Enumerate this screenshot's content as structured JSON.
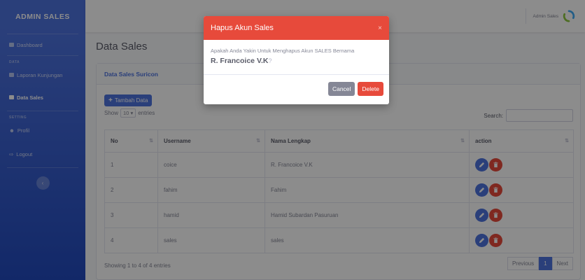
{
  "sidebar": {
    "brand": "ADMIN SALES",
    "dashboard": "Dashboard",
    "heading_data": "DATA",
    "laporan": "Laporan Kunjungan",
    "data_sales": "Data Sales",
    "heading_setting": "SETTING",
    "profil": "Profil",
    "logout": "Logout",
    "toggle": "‹"
  },
  "topbar": {
    "user_name": "Admin Sales"
  },
  "page": {
    "title": "Data Sales",
    "card_title": "Data Sales Suricon",
    "add_button": "Tambah Data",
    "show_label": "Show",
    "page_length": "10",
    "entries_label": "entries",
    "search_label": "Search:",
    "info": "Showing 1 to 4 of 4 entries",
    "prev": "Previous",
    "current_page": "1",
    "next": "Next"
  },
  "table": {
    "columns": [
      "No",
      "Username",
      "Nama Lengkap",
      "action"
    ],
    "rows": [
      [
        "1",
        "coice",
        "R. Francoice V.K"
      ],
      [
        "2",
        "fahim",
        "Fahim"
      ],
      [
        "3",
        "hamid",
        "Hamid Subardan Pasuruan"
      ],
      [
        "4",
        "sales",
        "sales"
      ]
    ]
  },
  "modal": {
    "title": "Hapus Akun Sales",
    "close": "×",
    "message": "Apakah Anda Yakin Untuk Menghapus Akun SALES Bernama",
    "name": "R. Francoice V.K",
    "question": "?",
    "cancel": "Cancel",
    "delete": "Delete"
  },
  "colors": {
    "primary": "#4e73df",
    "danger": "#e74a3b",
    "secondary": "#858796"
  }
}
